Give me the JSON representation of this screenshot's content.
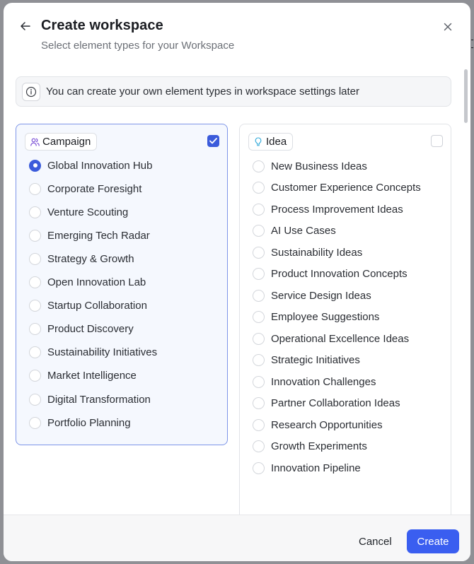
{
  "dialog": {
    "title": "Create workspace",
    "subtitle": "Select element types for your Workspace",
    "info_text": "You can create your own element types in workspace settings later"
  },
  "columns": [
    {
      "label": "Campaign",
      "icon": "users-icon",
      "checked": true,
      "selected_index": 0,
      "options": [
        "Global Innovation Hub",
        "Corporate Foresight",
        "Venture Scouting",
        "Emerging Tech Radar",
        "Strategy & Growth",
        "Open Innovation Lab",
        "Startup Collaboration",
        "Product Discovery",
        "Sustainability Initiatives",
        "Market Intelligence",
        "Digital Transformation",
        "Portfolio Planning"
      ]
    },
    {
      "label": "Idea",
      "icon": "lightbulb-icon",
      "checked": false,
      "selected_index": null,
      "options": [
        "New Business Ideas",
        "Customer Experience Concepts",
        "Process Improvement Ideas",
        "AI Use Cases",
        "Sustainability Ideas",
        "Product Innovation Concepts",
        "Service Design Ideas",
        "Employee Suggestions",
        "Operational Excellence Ideas",
        "Strategic Initiatives",
        "Innovation Challenges",
        "Partner Collaboration Ideas",
        "Research Opportunities",
        "Growth Experiments",
        "Innovation Pipeline"
      ]
    }
  ],
  "footer": {
    "cancel_label": "Cancel",
    "create_label": "Create"
  },
  "colors": {
    "accent": "#3a5ef0",
    "campaign_icon": "#7b4fd6",
    "idea_icon": "#2aa6d8"
  }
}
